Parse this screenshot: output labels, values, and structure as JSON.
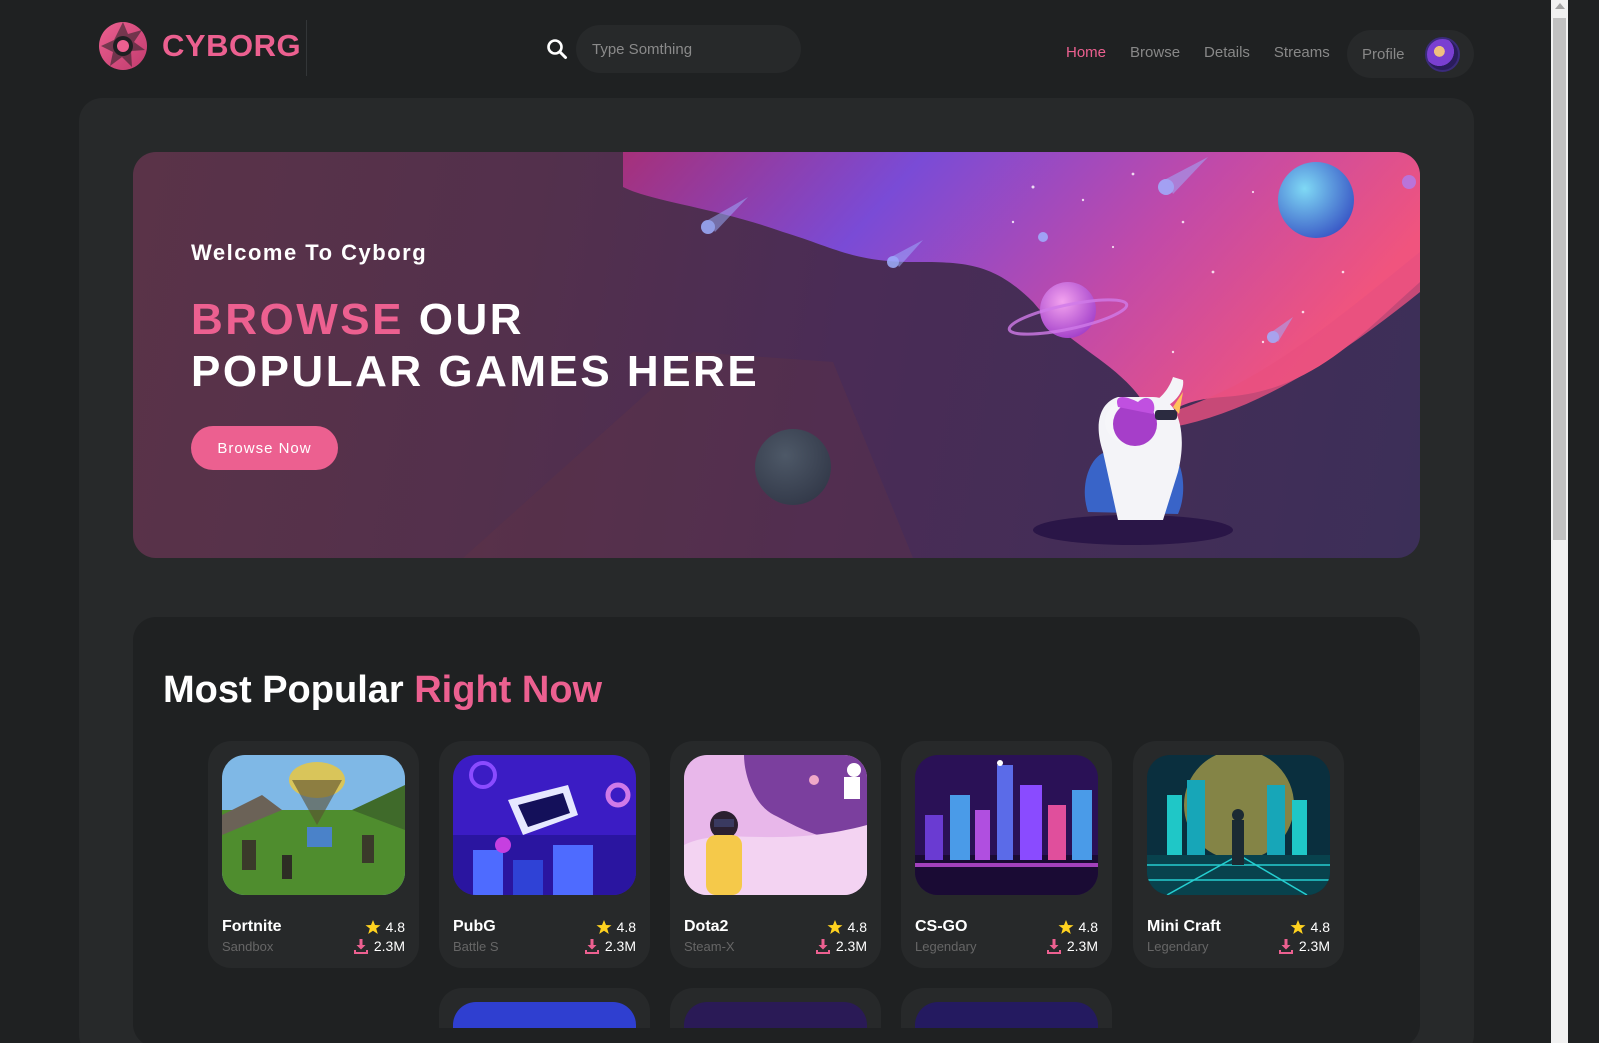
{
  "brand": {
    "name": "CYBORG",
    "accent": "#ec6090"
  },
  "search": {
    "placeholder": "Type Somthing"
  },
  "nav": {
    "items": [
      "Home",
      "Browse",
      "Details",
      "Streams"
    ],
    "active": "Home"
  },
  "profile": {
    "label": "Profile"
  },
  "banner": {
    "subtitle": "Welcome To Cyborg",
    "title_highlight": "BROWSE",
    "title_rest_line1": " OUR",
    "title_line2": "POPULAR GAMES HERE",
    "button": "Browse Now"
  },
  "popular": {
    "title_plain": "Most Popular ",
    "title_highlight": "Right Now",
    "cards": [
      {
        "name": "Fortnite",
        "category": "Sandbox",
        "rating": "4.8",
        "downloads": "2.3M"
      },
      {
        "name": "PubG",
        "category": "Battle S",
        "rating": "4.8",
        "downloads": "2.3M"
      },
      {
        "name": "Dota2",
        "category": "Steam-X",
        "rating": "4.8",
        "downloads": "2.3M"
      },
      {
        "name": "CS-GO",
        "category": "Legendary",
        "rating": "4.8",
        "downloads": "2.3M"
      },
      {
        "name": "Mini Craft",
        "category": "Legendary",
        "rating": "4.8",
        "downloads": "2.3M"
      }
    ]
  }
}
